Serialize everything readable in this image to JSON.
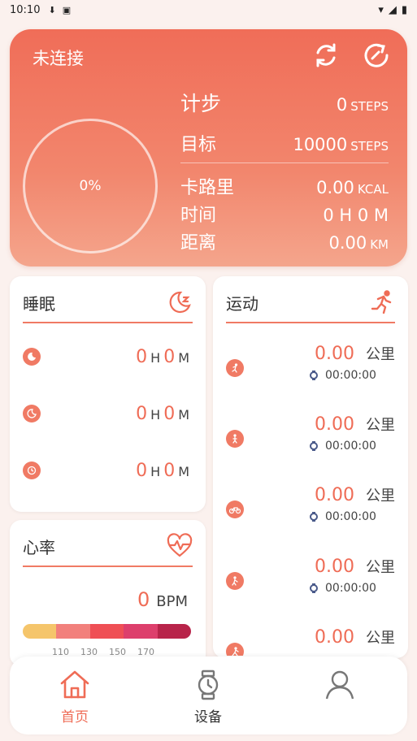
{
  "status_bar": {
    "time": "10:10",
    "battery": "▮"
  },
  "summary": {
    "connection_status": "未连接",
    "progress_percent": "0%",
    "steps": {
      "label": "计步",
      "value": "0",
      "unit": "STEPS"
    },
    "goal": {
      "label": "目标",
      "value": "10000",
      "unit": "STEPS"
    },
    "calories": {
      "label": "卡路里",
      "value": "0.00",
      "unit": "KCAL"
    },
    "time": {
      "label": "时间",
      "value": "0 H 0 M"
    },
    "distance": {
      "label": "距离",
      "value": "0.00",
      "unit": "KM"
    }
  },
  "sleep": {
    "title": "睡眠",
    "rows": [
      {
        "h": "0",
        "h_unit": "H",
        "m": "0",
        "m_unit": "M"
      },
      {
        "h": "0",
        "h_unit": "H",
        "m": "0",
        "m_unit": "M"
      },
      {
        "h": "0",
        "h_unit": "H",
        "m": "0",
        "m_unit": "M"
      }
    ]
  },
  "heart_rate": {
    "title": "心率",
    "value": "0",
    "unit": "BPM",
    "zone_colors": [
      "#f5c56b",
      "#f2807c",
      "#ef4f55",
      "#dd3f6c",
      "#b8244a"
    ],
    "ticks": [
      "110",
      "130",
      "150",
      "170"
    ]
  },
  "sport": {
    "title": "运动",
    "rows": [
      {
        "icon": "run-icon",
        "distance": "0.00",
        "unit": "公里",
        "time": "00:00:00"
      },
      {
        "icon": "walk-icon",
        "distance": "0.00",
        "unit": "公里",
        "time": "00:00:00"
      },
      {
        "icon": "bike-icon",
        "distance": "0.00",
        "unit": "公里",
        "time": "00:00:00"
      },
      {
        "icon": "hike-icon",
        "distance": "0.00",
        "unit": "公里",
        "time": "00:00:00"
      },
      {
        "icon": "climb-icon",
        "distance": "0.00",
        "unit": "公里"
      }
    ]
  },
  "nav": {
    "home": "首页",
    "device": "设备"
  },
  "colors": {
    "accent": "#ef6c56",
    "card_bg": "#ffffff",
    "page_bg": "#fbf1ee"
  }
}
